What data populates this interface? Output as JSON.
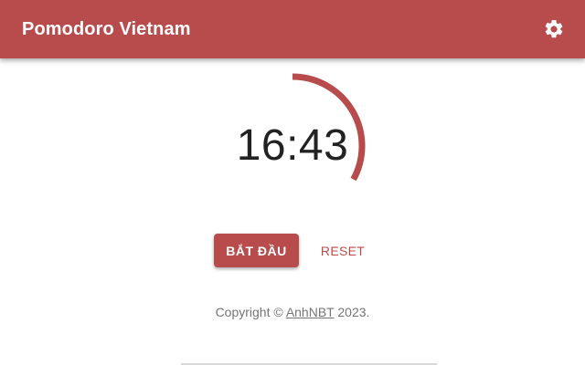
{
  "app": {
    "title": "Pomodoro Vietnam",
    "accent_color": "#b84c4c"
  },
  "header": {
    "settings_icon": "gear-icon"
  },
  "timer": {
    "display": "16:43",
    "progress_fraction": 0.33
  },
  "controls": {
    "start_label": "BẮT ĐẦU",
    "reset_label": "RESET"
  },
  "footer": {
    "prefix": "Copyright ©",
    "author": "AnhNBT",
    "suffix": "2023."
  }
}
